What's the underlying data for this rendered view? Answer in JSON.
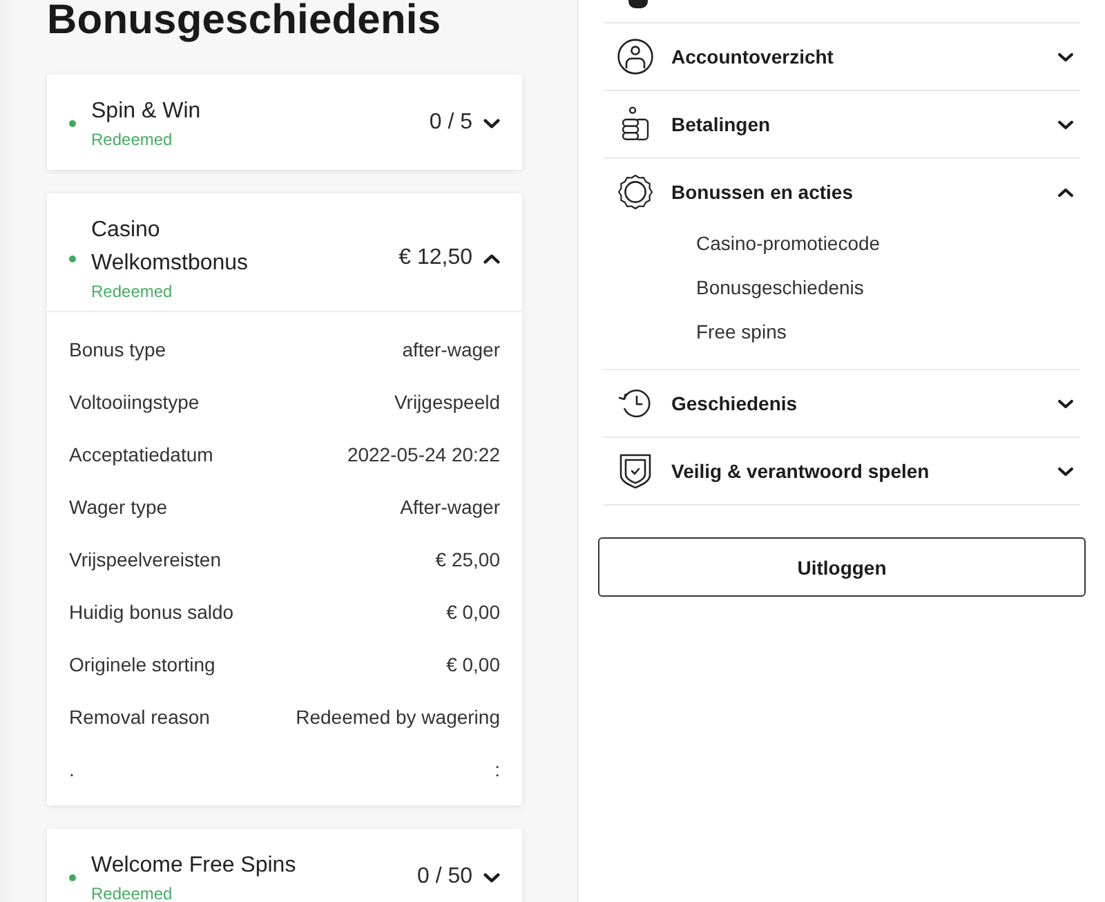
{
  "page_title": "Bonusgeschiedenis",
  "bonuses": [
    {
      "title": "Spin & Win",
      "status": "Redeemed",
      "amount": "0 / 5",
      "expanded": false
    },
    {
      "title": "Casino Welkomstbonus",
      "status": "Redeemed",
      "amount": "€ 12,50",
      "expanded": true,
      "details": [
        {
          "label": "Bonus type",
          "value": "after-wager"
        },
        {
          "label": "Voltooiingstype",
          "value": "Vrijgespeeld"
        },
        {
          "label": "Acceptatiedatum",
          "value": "2022-05-24 20:22"
        },
        {
          "label": "Wager type",
          "value": "After-wager"
        },
        {
          "label": "Vrijspeelvereisten",
          "value": "€ 25,00"
        },
        {
          "label": "Huidig bonus saldo",
          "value": "€ 0,00"
        },
        {
          "label": "Originele storting",
          "value": "€ 0,00"
        },
        {
          "label": "Removal reason",
          "value": "Redeemed by wagering"
        },
        {
          "label": ".",
          "value": ":"
        }
      ]
    },
    {
      "title": "Welcome Free Spins",
      "status": "Redeemed",
      "amount": "0 / 50",
      "expanded": false
    }
  ],
  "account_menu": {
    "items": [
      {
        "label": "Accountoverzicht",
        "expanded": false
      },
      {
        "label": "Betalingen",
        "expanded": false
      },
      {
        "label": "Bonussen en acties",
        "expanded": true,
        "subitems": [
          "Casino-promotiecode",
          "Bonusgeschiedenis",
          "Free spins"
        ]
      },
      {
        "label": "Geschiedenis",
        "expanded": false
      },
      {
        "label": "Veilig & verantwoord spelen",
        "expanded": false
      }
    ]
  },
  "logout_button": "Uitloggen"
}
